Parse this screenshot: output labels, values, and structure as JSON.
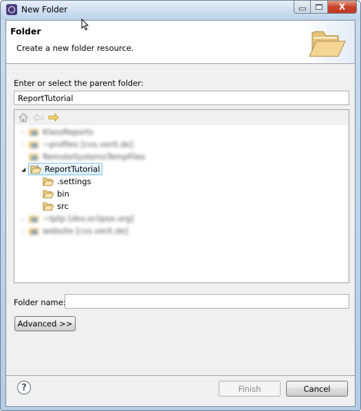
{
  "window": {
    "title": "New Folder",
    "controls": {
      "minimize": "minimize",
      "maximize": "maximize",
      "close": "X"
    }
  },
  "banner": {
    "title": "Folder",
    "description": "Create a new folder resource."
  },
  "parent": {
    "label": "Enter or select the parent folder:",
    "value": "ReportTutorial"
  },
  "tree_toolbar": {
    "icons": [
      "home-icon",
      "back-icon",
      "forward-icon"
    ]
  },
  "tree": {
    "nodes": [
      {
        "label": "KlassReports",
        "depth": 0,
        "expander": "collapsed",
        "blurred": true
      },
      {
        "label": "~profiles  [cvs.verit.de]",
        "depth": 0,
        "expander": "collapsed",
        "blurred": true
      },
      {
        "label": "RemoteSystemsTempFiles",
        "depth": 0,
        "expander": "none",
        "blurred": true
      },
      {
        "label": "ReportTutorial",
        "depth": 0,
        "expander": "expanded",
        "blurred": false,
        "selected": true
      },
      {
        "label": ".settings",
        "depth": 1,
        "expander": "none",
        "blurred": false
      },
      {
        "label": "bin",
        "depth": 1,
        "expander": "none",
        "blurred": false
      },
      {
        "label": "src",
        "depth": 1,
        "expander": "none",
        "blurred": false
      },
      {
        "label": "~tptp  [dev.eclipse.org]",
        "depth": 0,
        "expander": "collapsed",
        "blurred": true
      },
      {
        "label": "website  [cvs.verit.de]",
        "depth": 0,
        "expander": "collapsed",
        "blurred": true
      }
    ]
  },
  "folder_name": {
    "label": "Folder name:",
    "value": ""
  },
  "buttons": {
    "advanced": "Advanced >>",
    "finish": "Finish",
    "cancel": "Cancel",
    "help": "?"
  }
}
